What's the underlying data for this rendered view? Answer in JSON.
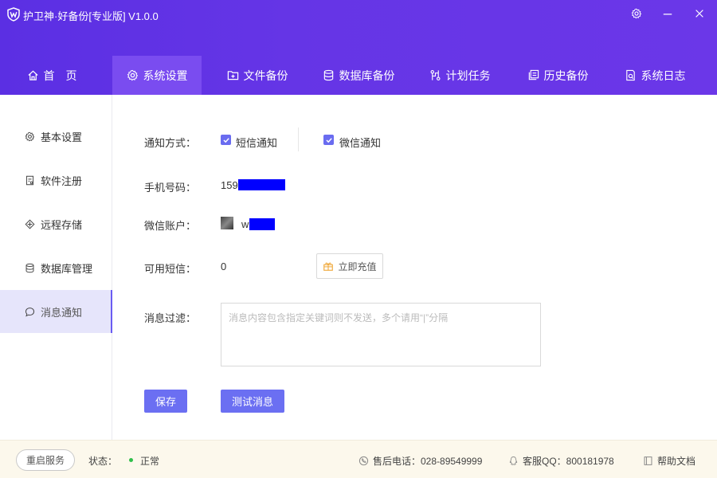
{
  "app": {
    "title": "护卫神·好备份[专业版]  V1.0.0",
    "accent_color": "#6535e6",
    "window_buttons": [
      "gear-icon",
      "minimize-icon",
      "close-icon"
    ]
  },
  "nav": {
    "tabs": [
      {
        "label": "首　页",
        "icon": "home-icon"
      },
      {
        "label": "系统设置",
        "icon": "gear-icon",
        "active": true
      },
      {
        "label": "文件备份",
        "icon": "folder-plus-icon"
      },
      {
        "label": "数据库备份",
        "icon": "database-icon"
      },
      {
        "label": "计划任务",
        "icon": "schedule-icon"
      },
      {
        "label": "历史备份",
        "icon": "history-icon"
      },
      {
        "label": "系统日志",
        "icon": "log-icon"
      }
    ]
  },
  "sidebar": {
    "items": [
      {
        "label": "基本设置",
        "icon": "gear-icon"
      },
      {
        "label": "软件注册",
        "icon": "register-icon"
      },
      {
        "label": "远程存储",
        "icon": "remote-storage-icon"
      },
      {
        "label": "数据库管理",
        "icon": "database-icon"
      },
      {
        "label": "消息通知",
        "icon": "chat-icon",
        "active": true
      }
    ]
  },
  "notify": {
    "method_label": "通知方式：",
    "sms_label": "短信通知",
    "sms_checked": true,
    "wechat_label": "微信通知",
    "wechat_checked": true,
    "phone_label": "手机号码：",
    "phone_value": "159",
    "wechat_account_label": "微信账户：",
    "wechat_account_value": "w",
    "sms_balance_label": "可用短信：",
    "sms_balance_value": "0",
    "recharge_label": "立即充值",
    "filter_label": "消息过滤：",
    "filter_placeholder": "消息内容包含指定关键词则不发送，多个请用“|”分隔",
    "filter_value": "",
    "save_label": "保存",
    "test_label": "测试消息"
  },
  "footer": {
    "restart_label": "重启服务",
    "status_label": "状态：",
    "status_value": "正常",
    "status_color": "#2fbf4b",
    "phone_text": "售后电话：028-89549999",
    "qq_text": "客服QQ：800181978",
    "help_text": "帮助文档"
  }
}
